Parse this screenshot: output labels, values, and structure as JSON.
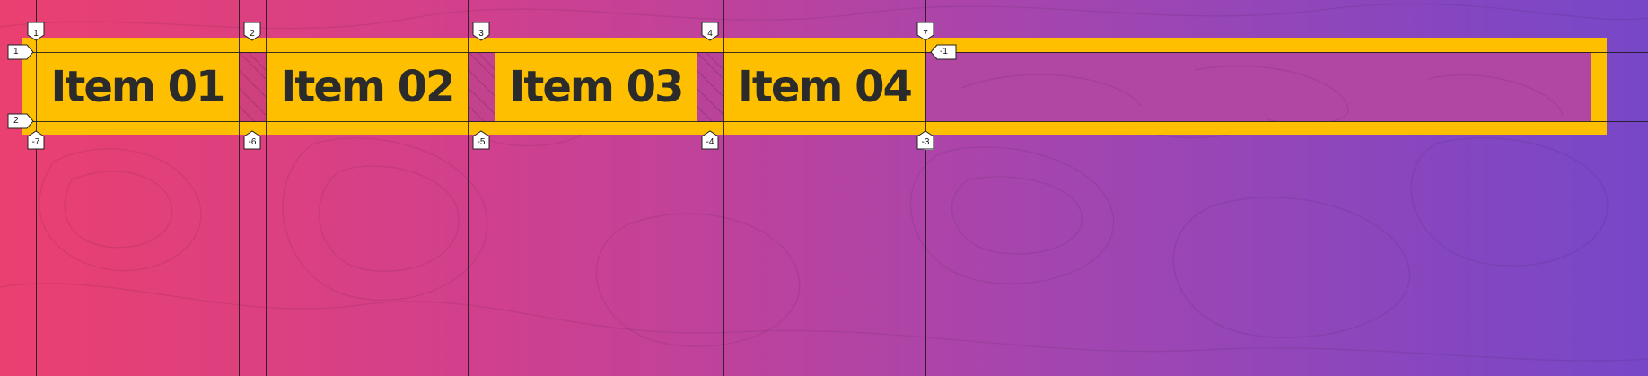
{
  "items": [
    {
      "label": "Item 01"
    },
    {
      "label": "Item 02"
    },
    {
      "label": "Item 03"
    },
    {
      "label": "Item 04"
    }
  ],
  "column_markers_top": [
    "1",
    "2",
    "3",
    "4",
    "7"
  ],
  "column_markers_bottom": [
    "-7",
    "-6",
    "-5",
    "-4",
    "-3"
  ],
  "row_markers_left": [
    "1",
    "2"
  ],
  "row_markers_right": [
    "-1"
  ],
  "colors": {
    "item_fill": "#fdbf00",
    "text": "#2b2b2b",
    "grid_line": "#1a1a1a",
    "background_start": "#ea4070",
    "background_end": "#7747c8"
  }
}
